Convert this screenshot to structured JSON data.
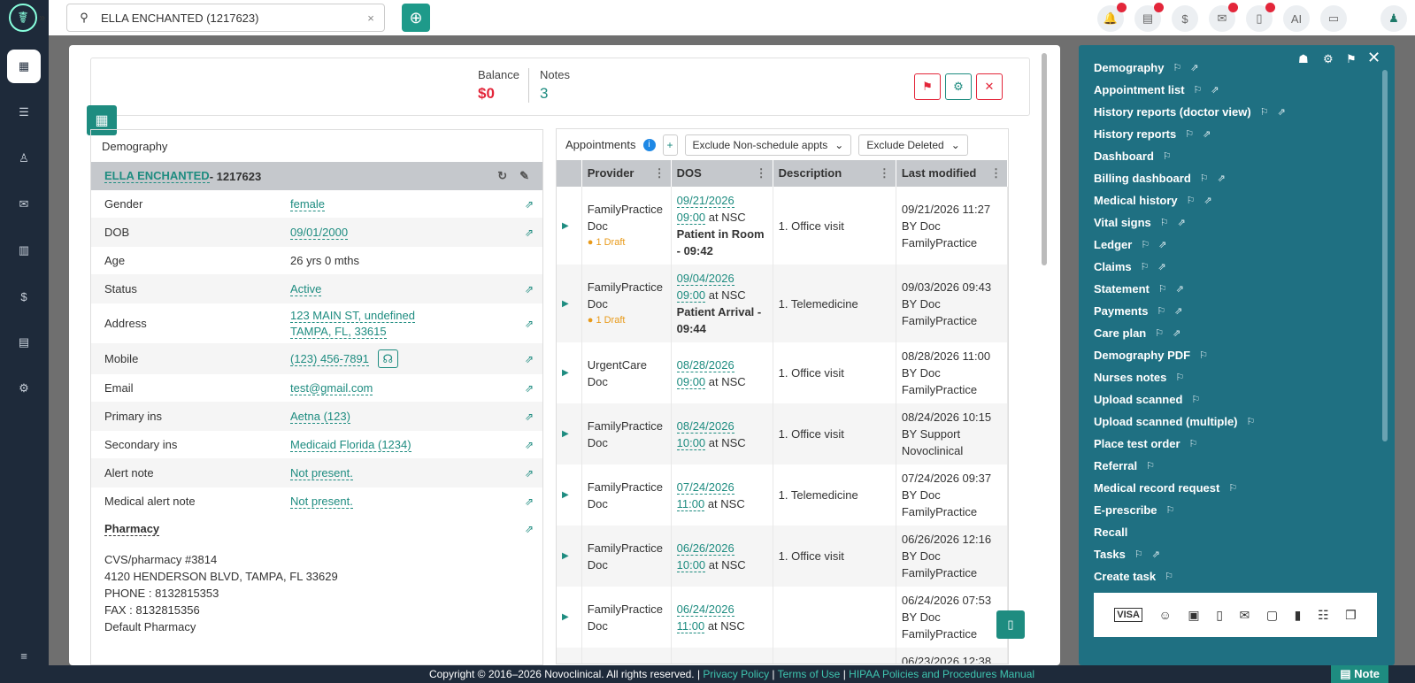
{
  "search": {
    "value": "ELLA ENCHANTED (1217623)"
  },
  "header": {
    "balance_label": "Balance",
    "balance_value": "$0",
    "notes_label": "Notes",
    "notes_value": "3"
  },
  "demography": {
    "title": "Demography",
    "patient_name": "ELLA ENCHANTED",
    "patient_id": " - 1217623",
    "rows": [
      {
        "key": "Gender",
        "value": "female"
      },
      {
        "key": "DOB",
        "value": "09/01/2000"
      },
      {
        "key": "Age",
        "value": "26 yrs 0 mths"
      },
      {
        "key": "Status",
        "value": "Active"
      },
      {
        "key": "Address",
        "value": "123 MAIN ST, undefined",
        "value2": "TAMPA, FL, 33615"
      },
      {
        "key": "Mobile",
        "value": "(123) 456-7891"
      },
      {
        "key": "Email",
        "value": "test@gmail.com"
      },
      {
        "key": "Primary ins",
        "value": "Aetna (123)"
      },
      {
        "key": "Secondary ins",
        "value": "Medicaid Florida (1234)"
      },
      {
        "key": "Alert note",
        "value": "Not present."
      },
      {
        "key": "Medical alert note",
        "value": "Not present."
      }
    ],
    "pharmacy_label": "Pharmacy",
    "pharmacy_lines": [
      "CVS/pharmacy #3814",
      "4120 HENDERSON BLVD, TAMPA, FL 33629",
      "PHONE : 8132815353",
      "FAX : 8132815356",
      "Default Pharmacy"
    ]
  },
  "appointments": {
    "title": "Appointments",
    "filter1": "Exclude Non-schedule appts",
    "filter2": "Exclude Deleted",
    "columns": [
      "Provider",
      "DOS",
      "Description",
      "Last modified"
    ],
    "rows": [
      {
        "provider": "FamilyPractice Doc",
        "draft": "1 Draft",
        "date": "09/21/2026",
        "time": "09:00",
        "at": " at NSC",
        "status": "Patient in Room - 09:42",
        "desc": "1. Office visit",
        "mod": "09/21/2026 11:27 BY Doc FamilyPractice"
      },
      {
        "provider": "FamilyPractice Doc",
        "draft": "1 Draft",
        "date": "09/04/2026",
        "time": "09:00",
        "at": " at NSC",
        "status": "Patient Arrival - 09:44",
        "desc": "1. Telemedicine",
        "mod": "09/03/2026 09:43 BY Doc FamilyPractice"
      },
      {
        "provider": "UrgentCare Doc",
        "draft": "",
        "date": "08/28/2026",
        "time": "09:00",
        "at": " at NSC",
        "status": "",
        "desc": "1. Office visit",
        "mod": "08/28/2026 11:00 BY Doc FamilyPractice"
      },
      {
        "provider": "FamilyPractice Doc",
        "draft": "",
        "date": "08/24/2026",
        "time": "10:00",
        "at": " at NSC",
        "status": "",
        "desc": "1. Office visit",
        "mod": "08/24/2026 10:15 BY Support Novoclinical"
      },
      {
        "provider": "FamilyPractice Doc",
        "draft": "",
        "date": "07/24/2026",
        "time": "11:00",
        "at": " at NSC",
        "status": "",
        "desc": "1. Telemedicine",
        "mod": "07/24/2026 09:37 BY Doc FamilyPractice"
      },
      {
        "provider": "FamilyPractice Doc",
        "draft": "",
        "date": "06/26/2026",
        "time": "10:00",
        "at": " at NSC",
        "status": "",
        "desc": "1. Office visit",
        "mod": "06/26/2026 12:16 BY Doc FamilyPractice"
      },
      {
        "provider": "FamilyPractice Doc",
        "draft": "",
        "date": "06/24/2026",
        "time": "11:00",
        "at": " at NSC",
        "status": "",
        "desc": "",
        "mod": "06/24/2026 07:53 BY Doc FamilyPractice"
      },
      {
        "provider": "",
        "draft": "",
        "date": "",
        "time": "",
        "at": "",
        "status": "",
        "desc": "",
        "mod": "06/23/2026 12:38"
      }
    ]
  },
  "right_panel": {
    "items": [
      "Demography",
      "Appointment list",
      "History reports (doctor view)",
      "History reports",
      "Dashboard",
      "Billing dashboard",
      "Medical history",
      "Vital signs",
      "Ledger",
      "Claims",
      "Statement",
      "Payments",
      "Care plan",
      "Demography PDF",
      "Nurses notes",
      "Upload scanned",
      "Upload scanned (multiple)",
      "Place test order",
      "Referral",
      "Medical record request",
      "E-prescribe",
      "Recall",
      "Tasks",
      "Create task"
    ]
  },
  "footer": {
    "copyright": "Copyright © 2016–2026 Novoclinical. All rights reserved. | ",
    "privacy": "Privacy Policy",
    "terms": "Terms of Use",
    "hipaa": "HIPAA Policies and Procedures Manual",
    "note_button": "Note"
  }
}
